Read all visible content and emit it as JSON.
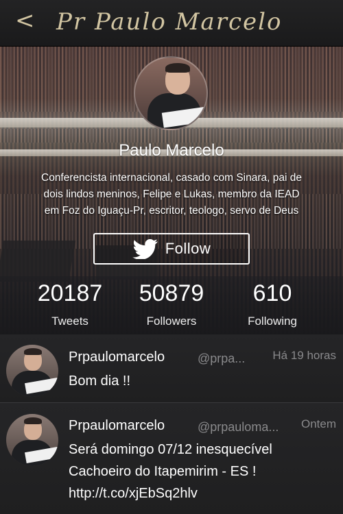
{
  "topbar": {
    "back_glyph": "<",
    "title": "Pr Paulo Marcelo"
  },
  "profile": {
    "name": "Paulo Marcelo",
    "bio_lines": [
      "Conferencista internacional, casado com Sinara, pai de",
      "dois lindos meninos, Felipe e Lukas, membro da IEAD",
      "em Foz do Iguaçu-Pr, escritor, teologo, servo de Deus"
    ],
    "follow_label": "Follow",
    "follow_icon": "twitter-bird-icon",
    "stats": [
      {
        "value": "20187",
        "label": "Tweets"
      },
      {
        "value": "50879",
        "label": "Followers"
      },
      {
        "value": "610",
        "label": "Following"
      }
    ]
  },
  "tweets": [
    {
      "user": "Prpaulomarcelo",
      "handle": "@prpa...",
      "time": "Há 19 horas",
      "lines": [
        "Bom dia !!"
      ]
    },
    {
      "user": "Prpaulomarcelo",
      "handle": "@prpauloma...",
      "time": "Ontem",
      "lines": [
        "Será domingo 07/12 inesquecível",
        "Cachoeiro do Itapemirim - ES !",
        "http://t.co/xjEbSq2hlv"
      ]
    }
  ],
  "colors": {
    "title_gold": "#d2c5a2",
    "background": "#1e1e1f",
    "muted_text": "#8a8a8c"
  }
}
